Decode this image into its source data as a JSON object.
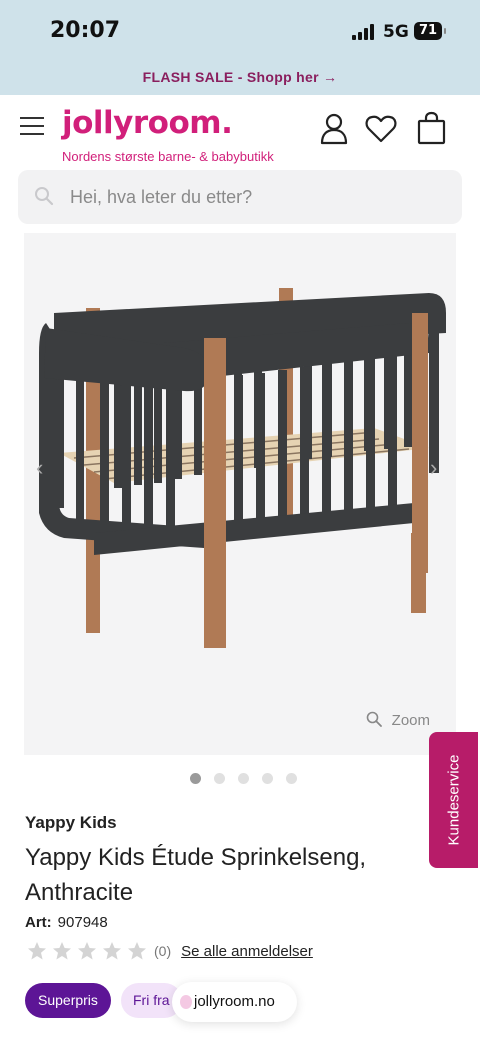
{
  "status_bar": {
    "time": "20:07",
    "network": "5G",
    "battery": "71"
  },
  "promo": {
    "text": "FLASH SALE - Shopp her →"
  },
  "header": {
    "logo": "jollyroom.",
    "tagline": "Nordens største barne- & babybutikk"
  },
  "search": {
    "placeholder": "Hei, hva leter du etter?"
  },
  "gallery": {
    "zoom_label": "Zoom",
    "active_index": 0,
    "image_count": 5
  },
  "kundeservice": {
    "label": "Kundeservice"
  },
  "product": {
    "brand": "Yappy Kids",
    "title": "Yappy Kids Étude Sprinkelseng, Anthracite",
    "art_label": "Art:",
    "art_number": "907948",
    "rating_count": "(0)",
    "reviews_link": "Se alle anmeldelser"
  },
  "badges": {
    "superpris": "Superpris",
    "fri_frakt": "Fri fra"
  },
  "browser": {
    "url": "jollyroom.no"
  },
  "colors": {
    "brand": "#d11f7a",
    "promo_bg": "#cfe2ea",
    "badge_purple": "#5d1596",
    "kundeservice": "#b71c69"
  },
  "icons": [
    "menu-icon",
    "user-icon",
    "heart-icon",
    "bag-icon",
    "search-icon",
    "zoom-icon",
    "star-icon",
    "lock-icon"
  ]
}
